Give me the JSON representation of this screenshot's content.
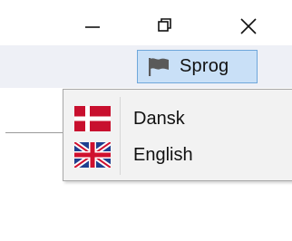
{
  "window": {
    "controls": {
      "minimize_icon": "minimize-icon",
      "restore_icon": "restore-icon",
      "close_icon": "close-icon"
    }
  },
  "toolbar": {
    "language_button": {
      "label": "Sprog",
      "icon": "flag-icon"
    }
  },
  "language_menu": {
    "items": [
      {
        "label": "Dansk",
        "icon": "denmark-flag-icon"
      },
      {
        "label": "English",
        "icon": "uk-flag-icon"
      }
    ]
  },
  "colors": {
    "button_bg": "#c9e0f7",
    "button_border": "#6fa7db",
    "toolbar_bg": "#eef0f6",
    "menu_bg": "#f2f2f2",
    "denmark_red": "#c8102e",
    "uk_blue": "#1f3f8f",
    "uk_red": "#d0102e"
  }
}
